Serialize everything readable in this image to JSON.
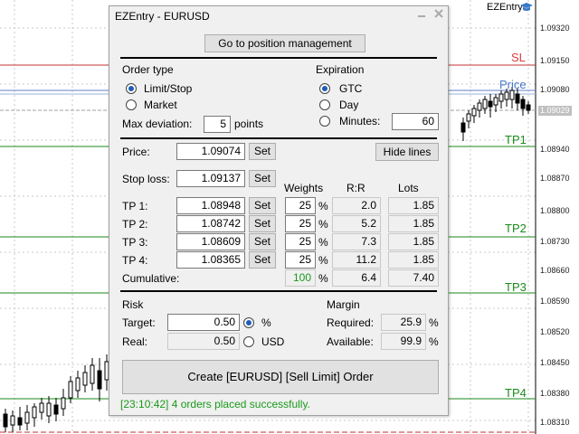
{
  "window": {
    "title": "EZEntry - EURUSD",
    "close_icon": "close-icon",
    "minimize_icon": "minimize-icon"
  },
  "brand": {
    "label": "EZEntry",
    "icon": "graduation-cap-icon"
  },
  "chart": {
    "symbol": "EURUSD",
    "price_axis": [
      "1.09320",
      "1.09150",
      "1.09080",
      "1.09029",
      "1.08940",
      "1.08870",
      "1.08800",
      "1.08730",
      "1.08660",
      "1.08590",
      "1.08520",
      "1.08450",
      "1.08380",
      "1.08310"
    ],
    "current_price": "1.09029",
    "lines": [
      {
        "name": "SL",
        "color": "#e03c3c"
      },
      {
        "name": "Price",
        "color": "#4a78c8"
      },
      {
        "name": "TP1",
        "color": "#1a8a1a"
      },
      {
        "name": "TP2",
        "color": "#1a8a1a"
      },
      {
        "name": "TP3",
        "color": "#1a8a1a"
      },
      {
        "name": "TP4",
        "color": "#1a8a1a"
      }
    ]
  },
  "top_button": "Go to position management",
  "order_type": {
    "heading": "Order type",
    "options": [
      "Limit/Stop",
      "Market"
    ],
    "selected": "Limit/Stop",
    "max_deviation_label": "Max deviation:",
    "max_deviation_value": "5",
    "max_deviation_unit": "points"
  },
  "expiration": {
    "heading": "Expiration",
    "options": [
      "GTC",
      "Day",
      "Minutes:"
    ],
    "selected": "GTC",
    "minutes_value": "60"
  },
  "price": {
    "label": "Price:",
    "value": "1.09074",
    "set": "Set",
    "hide_lines": "Hide lines"
  },
  "stop_loss": {
    "label": "Stop loss:",
    "value": "1.09137",
    "set": "Set"
  },
  "columns": {
    "weights": "Weights",
    "rr": "R:R",
    "lots": "Lots"
  },
  "tps": [
    {
      "label": "TP 1:",
      "value": "1.08948",
      "set": "Set",
      "weight": "25",
      "pct": "%",
      "rr": "2.0",
      "lots": "1.85"
    },
    {
      "label": "TP 2:",
      "value": "1.08742",
      "set": "Set",
      "weight": "25",
      "pct": "%",
      "rr": "5.2",
      "lots": "1.85"
    },
    {
      "label": "TP 3:",
      "value": "1.08609",
      "set": "Set",
      "weight": "25",
      "pct": "%",
      "rr": "7.3",
      "lots": "1.85"
    },
    {
      "label": "TP 4:",
      "value": "1.08365",
      "set": "Set",
      "weight": "25",
      "pct": "%",
      "rr": "11.2",
      "lots": "1.85"
    }
  ],
  "cumulative": {
    "label": "Cumulative:",
    "weight": "100",
    "pct": "%",
    "rr": "6.4",
    "lots": "7.40"
  },
  "risk": {
    "heading": "Risk",
    "target_label": "Target:",
    "target_value": "0.50",
    "real_label": "Real:",
    "real_value": "0.50",
    "options": [
      "%",
      "USD"
    ],
    "selected": "%"
  },
  "margin": {
    "heading": "Margin",
    "required_label": "Required:",
    "required_value": "25.9",
    "available_label": "Available:",
    "available_value": "99.9",
    "unit": "%"
  },
  "create_button": "Create [EURUSD] [Sell Limit] Order",
  "status": "[23:10:42] 4 orders placed successfully."
}
